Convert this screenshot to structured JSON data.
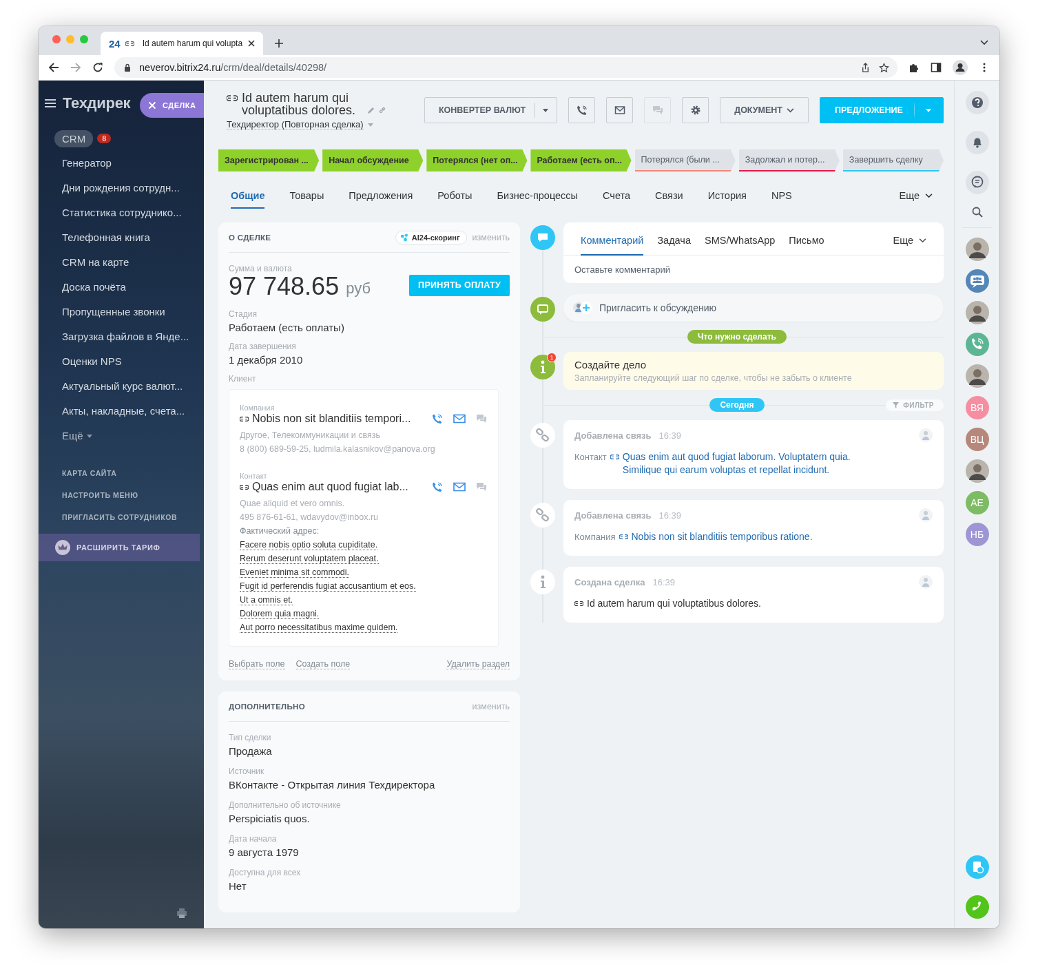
{
  "browser": {
    "tab_logo": "24",
    "tab_title": "Id autem harum qui volupta",
    "url_host": "neverov.bitrix24.ru",
    "url_path": "/crm/deal/details/40298/"
  },
  "sidebar": {
    "logo": "Техдирек",
    "items": [
      {
        "label": "CRM",
        "kind": "pill",
        "badge": "8"
      },
      {
        "label": "Генератор",
        "kind": "item"
      },
      {
        "label": "Дни рождения сотрудн...",
        "kind": "item"
      },
      {
        "label": "Статистика сотруднико...",
        "kind": "item"
      },
      {
        "label": "Телефонная книга",
        "kind": "item"
      },
      {
        "label": "CRM на карте",
        "kind": "item"
      },
      {
        "label": "Доска почёта",
        "kind": "item"
      },
      {
        "label": "Пропущенные звонки",
        "kind": "item"
      },
      {
        "label": "Загрузка файлов в Янде...",
        "kind": "item"
      },
      {
        "label": "Оценки NPS",
        "kind": "item"
      },
      {
        "label": "Актуальный курс валют...",
        "kind": "item"
      },
      {
        "label": "Акты, накладные, счета...",
        "kind": "item"
      },
      {
        "label": "Ещё",
        "kind": "more"
      }
    ],
    "links": [
      "КАРТА САЙТА",
      "НАСТРОИТЬ МЕНЮ",
      "ПРИГЛАСИТЬ СОТРУДНИКОВ"
    ],
    "upgrade": "РАСШИРИТЬ ТАРИФ"
  },
  "slider_tag": "СДЕЛКА",
  "deal": {
    "title": "Id autem harum qui voluptatibus dolores.",
    "category": "Техдиректор (Повторная сделка)"
  },
  "toolbar": {
    "converter": "КОНВЕРТЕР ВАЛЮТ",
    "document": "ДОКУМЕНТ",
    "proposal": "ПРЕДЛОЖЕНИЕ"
  },
  "stages": [
    {
      "label": "Зарегистрирован ...",
      "done": true,
      "color": "#8fd12b"
    },
    {
      "label": "Начал обсуждение",
      "done": true,
      "color": "#8fd12b"
    },
    {
      "label": "Потерялся (нет оп...",
      "done": true,
      "color": "#8fd12b"
    },
    {
      "label": "Работаем (есть оп...",
      "done": true,
      "color": "#8fd12b"
    },
    {
      "label": "Потерялся (были ...",
      "done": false,
      "color": "#f4877c"
    },
    {
      "label": "Задолжал и потер...",
      "done": false,
      "color": "#e8194a"
    },
    {
      "label": "Завершить сделку",
      "done": false,
      "color": "#2fc6f6"
    }
  ],
  "tabs": [
    {
      "label": "Общие",
      "kind": "tab",
      "selected": true
    },
    {
      "label": "Товары",
      "kind": "tab",
      "selected": false
    },
    {
      "label": "Предложения",
      "kind": "tab",
      "selected": false
    },
    {
      "label": "Роботы",
      "kind": "tab",
      "selected": false
    },
    {
      "label": "Бизнес-процессы",
      "kind": "tab",
      "selected": false
    },
    {
      "label": "Счета",
      "kind": "tab",
      "selected": false
    },
    {
      "label": "Связи",
      "kind": "tab",
      "selected": false
    },
    {
      "label": "История",
      "kind": "tab",
      "selected": false
    },
    {
      "label": "NPS",
      "kind": "tab",
      "selected": false
    },
    {
      "label": "Еще",
      "kind": "more",
      "selected": false
    }
  ],
  "about": {
    "heading": "О СДЕЛКЕ",
    "scoring": "AI24-скоринг",
    "edit": "изменить",
    "amount_label": "Сумма и валюта",
    "amount": "97 748.65",
    "currency": "руб",
    "pay_button": "ПРИНЯТЬ ОПЛАТУ",
    "fields": [
      {
        "label": "Стадия",
        "value": "Работаем (есть оплаты)"
      },
      {
        "label": "Дата завершения",
        "value": "1 декабря 2010"
      }
    ],
    "client_label": "Клиент",
    "client": [
      {
        "type": "Компания",
        "name": "Nobis non sit blanditiis tempori...",
        "lines": [
          "Другое, Телекоммуникации и связь",
          "8 (800) 689-59-25, ludmila.kalasnikov@panova.org"
        ]
      },
      {
        "type": "Контакт",
        "name": "Quas enim aut quod fugiat lab...",
        "lines": [
          "Quae aliquid et vero omnis.",
          "495 876-61-61, wdavydov@inbox.ru"
        ],
        "address_label": "Фактический адрес:",
        "address": [
          "Facere nobis optio soluta cupiditate.",
          "Rerum deserunt voluptatem placeat.",
          "Eveniet minima sit commodi.",
          "Fugit id perferendis fugiat accusantium et eos.",
          "Ut a omnis et.",
          "Dolorem quia magni.",
          "Aut porro necessitatibus maxime quidem."
        ]
      }
    ],
    "actions": [
      "Выбрать поле",
      "Создать поле"
    ],
    "delete": "Удалить раздел"
  },
  "extra": {
    "heading": "ДОПОЛНИТЕЛЬНО",
    "edit": "изменить",
    "fields": [
      {
        "label": "Тип сделки",
        "value": "Продажа"
      },
      {
        "label": "Источник",
        "value": "ВКонтакте - Открытая линия Техдиректора"
      },
      {
        "label": "Дополнительно об источнике",
        "value": "Perspiciatis quos."
      },
      {
        "label": "Дата начала",
        "value": "9 августа 1979"
      },
      {
        "label": "Доступна для всех",
        "value": "Нет"
      }
    ]
  },
  "timeline": {
    "composer_tabs": [
      {
        "label": "Комментарий",
        "selected": true
      },
      {
        "label": "Задача",
        "selected": false
      },
      {
        "label": "SMS/WhatsApp",
        "selected": false
      },
      {
        "label": "Письмо",
        "selected": false
      }
    ],
    "more": "Еще",
    "placeholder": "Оставьте комментарий",
    "invite": "Пригласить к обсуждению",
    "todo_label": "Что нужно сделать",
    "task": {
      "title": "Создайте дело",
      "hint": "Запланируйте следующий шаг по сделке, чтобы не забыть о клиенте",
      "badge": "1"
    },
    "today": "Сегодня",
    "filter": "ФИЛЬТР",
    "events": [
      {
        "kind": "link",
        "title": "Добавлена связь",
        "time": "16:39",
        "entity": "Контакт",
        "text": "Quas enim aut quod fugiat laborum. Voluptatem quia. Similique qui earum voluptas et repellat incidunt."
      },
      {
        "kind": "link",
        "title": "Добавлена связь",
        "time": "16:39",
        "entity": "Компания",
        "text": "Nobis non sit blanditiis temporibus ratione."
      },
      {
        "kind": "info",
        "title": "Создана сделка",
        "time": "16:39",
        "text": "Id autem harum qui voluptatibus dolores."
      }
    ]
  },
  "right_rail": {
    "avatars": [
      {
        "kind": "photo"
      },
      {
        "kind": "group"
      },
      {
        "kind": "photo"
      },
      {
        "kind": "call"
      },
      {
        "kind": "photo"
      },
      {
        "kind": "initials",
        "initials": "ВЯ",
        "color": "#f58ea1"
      },
      {
        "kind": "initials",
        "initials": "ВЦ",
        "color": "#b8877b"
      },
      {
        "kind": "photo"
      },
      {
        "kind": "initials",
        "initials": "АЕ",
        "color": "#7dbb64"
      },
      {
        "kind": "initials",
        "initials": "НБ",
        "color": "#9e96d4"
      }
    ]
  }
}
